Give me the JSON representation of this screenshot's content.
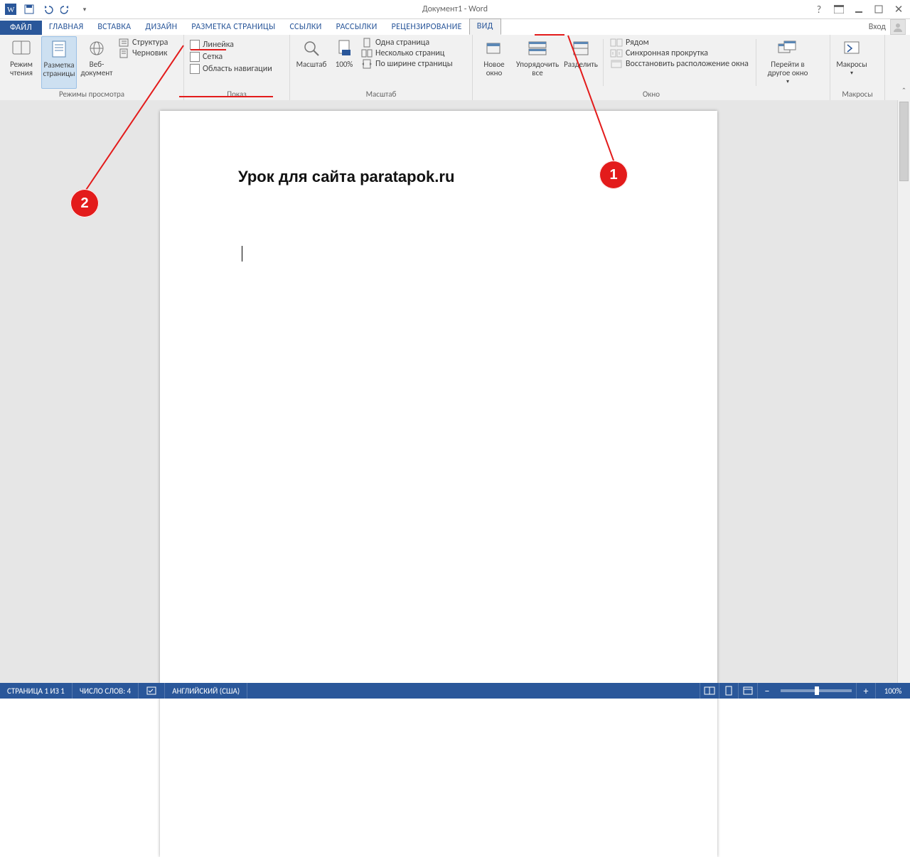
{
  "title": "Документ1 - Word",
  "login": "Вход",
  "tabs": {
    "file": "ФАЙЛ",
    "items": [
      "ГЛАВНАЯ",
      "ВСТАВКА",
      "ДИЗАЙН",
      "РАЗМЕТКА СТРАНИЦЫ",
      "ССЫЛКИ",
      "РАССЫЛКИ",
      "РЕЦЕНЗИРОВАНИЕ",
      "ВИД"
    ],
    "active": "ВИД"
  },
  "ribbon": {
    "group_views": {
      "label": "Режимы просмотра",
      "read": "Режим чтения",
      "print": "Разметка страницы",
      "web": "Веб-документ",
      "outline": "Структура",
      "draft": "Черновик"
    },
    "group_show": {
      "label": "Показ",
      "ruler": "Линейка",
      "grid": "Сетка",
      "nav": "Область навигации"
    },
    "group_zoom": {
      "label": "Масштаб",
      "zoom": "Масштаб",
      "p100": "100%",
      "one": "Одна страница",
      "many": "Несколько страниц",
      "width": "По ширине страницы"
    },
    "group_window": {
      "label": "Окно",
      "new": "Новое окно",
      "arrange": "Упорядочить все",
      "split": "Разделить",
      "side": "Рядом",
      "sync": "Синхронная прокрутка",
      "reset": "Восстановить расположение окна",
      "switch": "Перейти в другое окно"
    },
    "group_macros": {
      "label": "Макросы",
      "btn": "Макросы"
    }
  },
  "doc": {
    "heading": "Урок для сайта paratapok.ru"
  },
  "callouts": {
    "c1": "1",
    "c2": "2"
  },
  "status": {
    "page": "СТРАНИЦА 1 ИЗ 1",
    "words": "ЧИСЛО СЛОВ: 4",
    "lang": "АНГЛИЙСКИЙ (США)",
    "zoom": "100%"
  }
}
